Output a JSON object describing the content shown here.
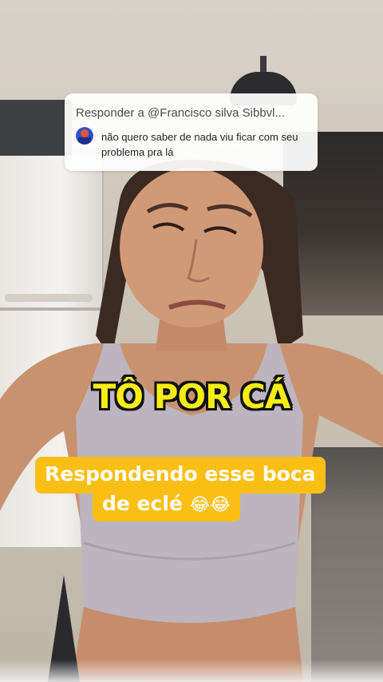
{
  "reply": {
    "header": "Responder a @Francisco silva Sibbvl...",
    "comment": "não quero saber de nada viu ficar com seu problema pra lá"
  },
  "caption": {
    "title": "TÔ POR CÁ",
    "line1": "Respondendo esse boca",
    "line2": "de eclé",
    "emoji": "😂😂"
  },
  "colors": {
    "caption_yellow": "#f7ed13",
    "sticker_bg": "#fbbf14",
    "card_bg": "#ffffff"
  }
}
